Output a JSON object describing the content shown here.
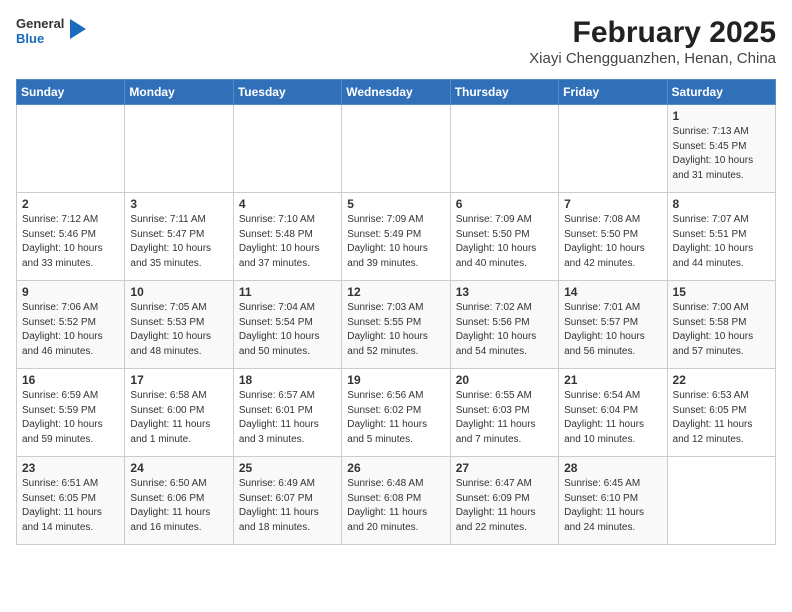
{
  "header": {
    "logo_general": "General",
    "logo_blue": "Blue",
    "title": "February 2025",
    "subtitle": "Xiayi Chengguanzhen, Henan, China"
  },
  "days_of_week": [
    "Sunday",
    "Monday",
    "Tuesday",
    "Wednesday",
    "Thursday",
    "Friday",
    "Saturday"
  ],
  "weeks": [
    [
      {
        "day": "",
        "info": ""
      },
      {
        "day": "",
        "info": ""
      },
      {
        "day": "",
        "info": ""
      },
      {
        "day": "",
        "info": ""
      },
      {
        "day": "",
        "info": ""
      },
      {
        "day": "",
        "info": ""
      },
      {
        "day": "1",
        "info": "Sunrise: 7:13 AM\nSunset: 5:45 PM\nDaylight: 10 hours and 31 minutes."
      }
    ],
    [
      {
        "day": "2",
        "info": "Sunrise: 7:12 AM\nSunset: 5:46 PM\nDaylight: 10 hours and 33 minutes."
      },
      {
        "day": "3",
        "info": "Sunrise: 7:11 AM\nSunset: 5:47 PM\nDaylight: 10 hours and 35 minutes."
      },
      {
        "day": "4",
        "info": "Sunrise: 7:10 AM\nSunset: 5:48 PM\nDaylight: 10 hours and 37 minutes."
      },
      {
        "day": "5",
        "info": "Sunrise: 7:09 AM\nSunset: 5:49 PM\nDaylight: 10 hours and 39 minutes."
      },
      {
        "day": "6",
        "info": "Sunrise: 7:09 AM\nSunset: 5:50 PM\nDaylight: 10 hours and 40 minutes."
      },
      {
        "day": "7",
        "info": "Sunrise: 7:08 AM\nSunset: 5:50 PM\nDaylight: 10 hours and 42 minutes."
      },
      {
        "day": "8",
        "info": "Sunrise: 7:07 AM\nSunset: 5:51 PM\nDaylight: 10 hours and 44 minutes."
      }
    ],
    [
      {
        "day": "9",
        "info": "Sunrise: 7:06 AM\nSunset: 5:52 PM\nDaylight: 10 hours and 46 minutes."
      },
      {
        "day": "10",
        "info": "Sunrise: 7:05 AM\nSunset: 5:53 PM\nDaylight: 10 hours and 48 minutes."
      },
      {
        "day": "11",
        "info": "Sunrise: 7:04 AM\nSunset: 5:54 PM\nDaylight: 10 hours and 50 minutes."
      },
      {
        "day": "12",
        "info": "Sunrise: 7:03 AM\nSunset: 5:55 PM\nDaylight: 10 hours and 52 minutes."
      },
      {
        "day": "13",
        "info": "Sunrise: 7:02 AM\nSunset: 5:56 PM\nDaylight: 10 hours and 54 minutes."
      },
      {
        "day": "14",
        "info": "Sunrise: 7:01 AM\nSunset: 5:57 PM\nDaylight: 10 hours and 56 minutes."
      },
      {
        "day": "15",
        "info": "Sunrise: 7:00 AM\nSunset: 5:58 PM\nDaylight: 10 hours and 57 minutes."
      }
    ],
    [
      {
        "day": "16",
        "info": "Sunrise: 6:59 AM\nSunset: 5:59 PM\nDaylight: 10 hours and 59 minutes."
      },
      {
        "day": "17",
        "info": "Sunrise: 6:58 AM\nSunset: 6:00 PM\nDaylight: 11 hours and 1 minute."
      },
      {
        "day": "18",
        "info": "Sunrise: 6:57 AM\nSunset: 6:01 PM\nDaylight: 11 hours and 3 minutes."
      },
      {
        "day": "19",
        "info": "Sunrise: 6:56 AM\nSunset: 6:02 PM\nDaylight: 11 hours and 5 minutes."
      },
      {
        "day": "20",
        "info": "Sunrise: 6:55 AM\nSunset: 6:03 PM\nDaylight: 11 hours and 7 minutes."
      },
      {
        "day": "21",
        "info": "Sunrise: 6:54 AM\nSunset: 6:04 PM\nDaylight: 11 hours and 10 minutes."
      },
      {
        "day": "22",
        "info": "Sunrise: 6:53 AM\nSunset: 6:05 PM\nDaylight: 11 hours and 12 minutes."
      }
    ],
    [
      {
        "day": "23",
        "info": "Sunrise: 6:51 AM\nSunset: 6:05 PM\nDaylight: 11 hours and 14 minutes."
      },
      {
        "day": "24",
        "info": "Sunrise: 6:50 AM\nSunset: 6:06 PM\nDaylight: 11 hours and 16 minutes."
      },
      {
        "day": "25",
        "info": "Sunrise: 6:49 AM\nSunset: 6:07 PM\nDaylight: 11 hours and 18 minutes."
      },
      {
        "day": "26",
        "info": "Sunrise: 6:48 AM\nSunset: 6:08 PM\nDaylight: 11 hours and 20 minutes."
      },
      {
        "day": "27",
        "info": "Sunrise: 6:47 AM\nSunset: 6:09 PM\nDaylight: 11 hours and 22 minutes."
      },
      {
        "day": "28",
        "info": "Sunrise: 6:45 AM\nSunset: 6:10 PM\nDaylight: 11 hours and 24 minutes."
      },
      {
        "day": "",
        "info": ""
      }
    ]
  ]
}
